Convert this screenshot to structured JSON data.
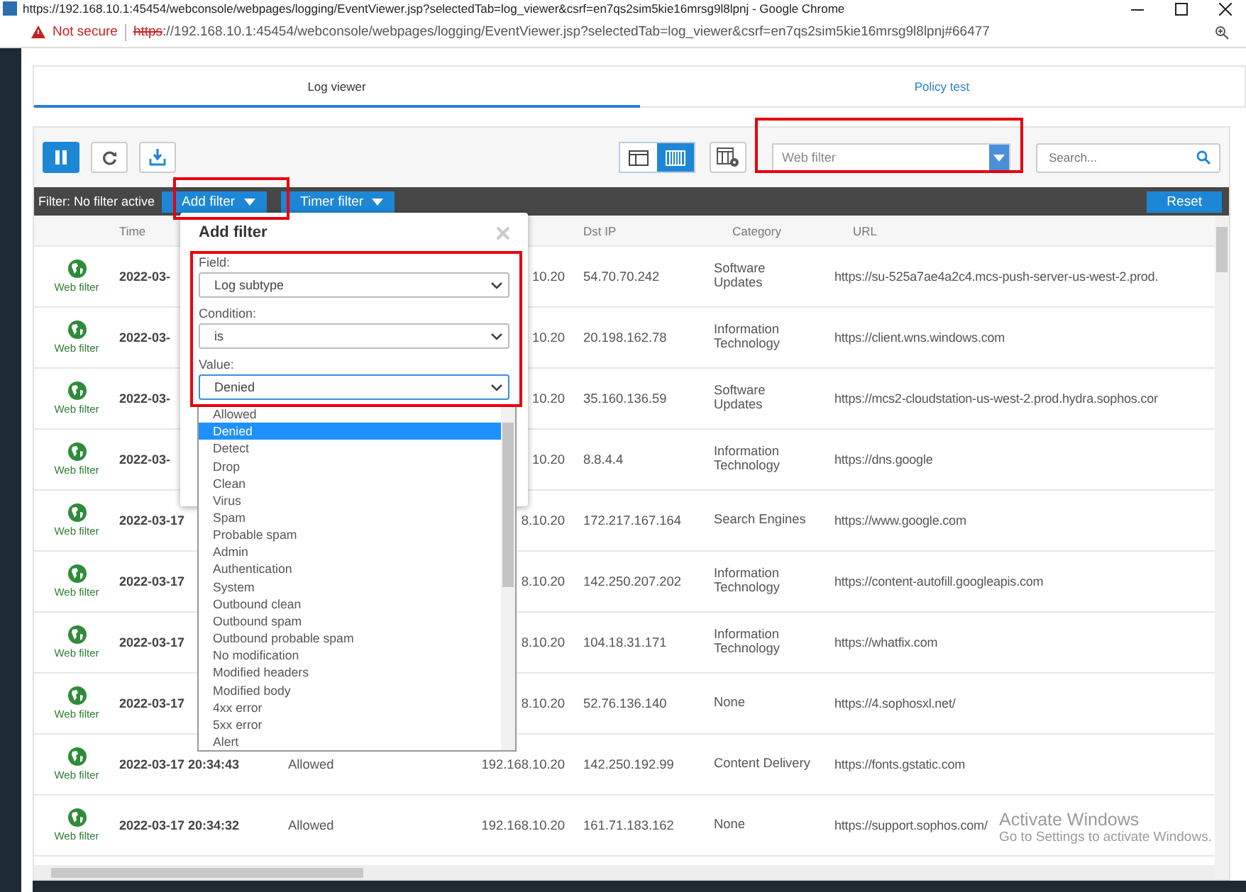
{
  "window": {
    "title": "https://192.168.10.1:45454/webconsole/webpages/logging/EventViewer.jsp?selectedTab=log_viewer&csrf=en7qs2sim5kie16mrsg9l8lpnj - Google Chrome"
  },
  "address_bar": {
    "security": "Not secure",
    "url_scheme": "https",
    "url_rest": "://192.168.10.1:45454/webconsole/webpages/logging/EventViewer.jsp?selectedTab=log_viewer&csrf=en7qs2sim5kie16mrsg9l8lpnj#66477"
  },
  "tabs": [
    {
      "label": "Log viewer",
      "selected": true
    },
    {
      "label": "Policy test",
      "selected": false
    }
  ],
  "toolbar": {
    "module_select": {
      "value": "Web filter"
    },
    "search": {
      "placeholder": "Search..."
    },
    "view_modes": [
      {
        "kind": "split",
        "selected": false
      },
      {
        "kind": "grid",
        "selected": true
      }
    ]
  },
  "filter_bar": {
    "status": "Filter: No filter active",
    "add_filter": "Add filter",
    "timer_filter": "Timer filter",
    "reset": "Reset"
  },
  "table": {
    "columns": [
      {
        "label": "Time"
      },
      {
        "label": "Dst IP"
      },
      {
        "label": "Category"
      },
      {
        "label": "URL"
      }
    ],
    "rows": [
      {
        "module": "Web filter",
        "time": "2022-03-",
        "src_ip": "10.20",
        "dst_ip": "54.70.70.242",
        "category": "Software Updates",
        "url": "https://su-525a7ae4a2c4.mcs-push-server-us-west-2.prod."
      },
      {
        "module": "Web filter",
        "time": "2022-03-",
        "src_ip": "10.20",
        "dst_ip": "20.198.162.78",
        "category": "Information Technology",
        "url": "https://client.wns.windows.com"
      },
      {
        "module": "Web filter",
        "time": "2022-03-",
        "src_ip": "10.20",
        "dst_ip": "35.160.136.59",
        "category": "Software Updates",
        "url": "https://mcs2-cloudstation-us-west-2.prod.hydra.sophos.cor"
      },
      {
        "module": "Web filter",
        "time": "2022-03-",
        "src_ip": "10.20",
        "dst_ip": "8.8.4.4",
        "category": "Information Technology",
        "url": "https://dns.google"
      },
      {
        "module": "Web filter",
        "time": "2022-03-17",
        "src_ip": "8.10.20",
        "dst_ip": "172.217.167.164",
        "category": "Search Engines",
        "url": "https://www.google.com"
      },
      {
        "module": "Web filter",
        "time": "2022-03-17",
        "src_ip": "8.10.20",
        "dst_ip": "142.250.207.202",
        "category": "Information Technology",
        "url": "https://content-autofill.googleapis.com"
      },
      {
        "module": "Web filter",
        "time": "2022-03-17",
        "src_ip": "8.10.20",
        "dst_ip": "104.18.31.171",
        "category": "Information Technology",
        "url": "https://whatfix.com"
      },
      {
        "module": "Web filter",
        "time": "2022-03-17",
        "src_ip": "8.10.20",
        "dst_ip": "52.76.136.140",
        "category": "None",
        "url": "https://4.sophosxl.net/"
      },
      {
        "module": "Web filter",
        "time": "2022-03-17 20:34:43",
        "action": "Allowed",
        "src_ip": "192.168.10.20",
        "dst_ip": "142.250.192.99",
        "category": "Content Delivery",
        "url": "https://fonts.gstatic.com"
      },
      {
        "module": "Web filter",
        "time": "2022-03-17 20:34:32",
        "action": "Allowed",
        "src_ip": "192.168.10.20",
        "dst_ip": "161.71.183.162",
        "category": "None",
        "url": "https://support.sophos.com/"
      }
    ]
  },
  "add_filter_dialog": {
    "title": "Add filter",
    "fields": [
      {
        "label": "Field:",
        "value": "Log subtype"
      },
      {
        "label": "Condition:",
        "value": "is"
      },
      {
        "label": "Value:",
        "value": "Denied",
        "focused": true
      }
    ],
    "value_options": [
      {
        "label": "Allowed",
        "selected": false
      },
      {
        "label": "Denied",
        "selected": true
      },
      {
        "label": "Detect",
        "selected": false
      },
      {
        "label": "Drop",
        "selected": false
      },
      {
        "label": "Clean",
        "selected": false
      },
      {
        "label": "Virus",
        "selected": false
      },
      {
        "label": "Spam",
        "selected": false
      },
      {
        "label": "Probable spam",
        "selected": false
      },
      {
        "label": "Admin",
        "selected": false
      },
      {
        "label": "Authentication",
        "selected": false
      },
      {
        "label": "System",
        "selected": false
      },
      {
        "label": "Outbound clean",
        "selected": false
      },
      {
        "label": "Outbound spam",
        "selected": false
      },
      {
        "label": "Outbound probable spam",
        "selected": false
      },
      {
        "label": "No modification",
        "selected": false
      },
      {
        "label": "Modified headers",
        "selected": false
      },
      {
        "label": "Modified body",
        "selected": false
      },
      {
        "label": "4xx error",
        "selected": false
      },
      {
        "label": "5xx error",
        "selected": false
      },
      {
        "label": "Alert",
        "selected": false
      }
    ]
  },
  "os_overlay": {
    "title": "Activate Windows",
    "subtitle": "Go to Settings to activate Windows."
  }
}
